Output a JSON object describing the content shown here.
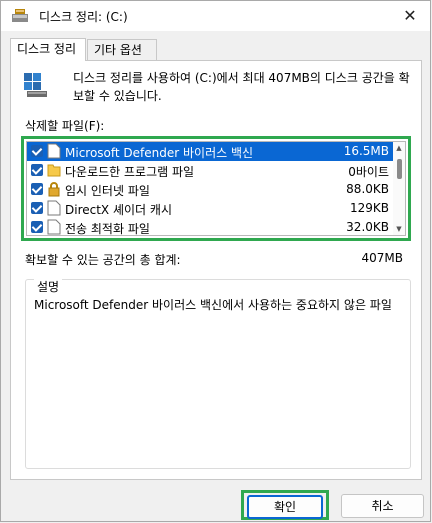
{
  "window": {
    "title": "디스크 정리: (C:)",
    "close_glyph": "✕"
  },
  "tabs": [
    {
      "label": "디스크 정리",
      "active": true
    },
    {
      "label": "기타 옵션",
      "active": false
    }
  ],
  "intro": "디스크 정리를 사용하여 (C:)에서 최대 407MB의 디스크 공간을 확보할 수 있습니다.",
  "files_label": "삭제할 파일(F):",
  "files": [
    {
      "name": "Microsoft Defender 바이러스 백신",
      "size": "16.5MB",
      "checked": true,
      "selected": true,
      "icon": "file-icon"
    },
    {
      "name": "다운로드한 프로그램 파일",
      "size": "0바이트",
      "checked": true,
      "selected": false,
      "icon": "folder-icon"
    },
    {
      "name": "임시 인터넷 파일",
      "size": "88.0KB",
      "checked": true,
      "selected": false,
      "icon": "lock-icon"
    },
    {
      "name": "DirectX 셰이더 캐시",
      "size": "129KB",
      "checked": true,
      "selected": false,
      "icon": "file-icon"
    },
    {
      "name": "전송 최적화 파일",
      "size": "32.0KB",
      "checked": true,
      "selected": false,
      "icon": "file-icon"
    }
  ],
  "total_label": "확보할 수 있는 공간의 총 합계:",
  "total_value": "407MB",
  "description": {
    "title": "설명",
    "text": "Microsoft Defender 바이러스 백신에서 사용하는 중요하지 않은 파일"
  },
  "buttons": {
    "ok": "확인",
    "cancel": "취소"
  },
  "colors": {
    "selection": "#0a67d3",
    "highlight_frame": "#2fa84f"
  }
}
